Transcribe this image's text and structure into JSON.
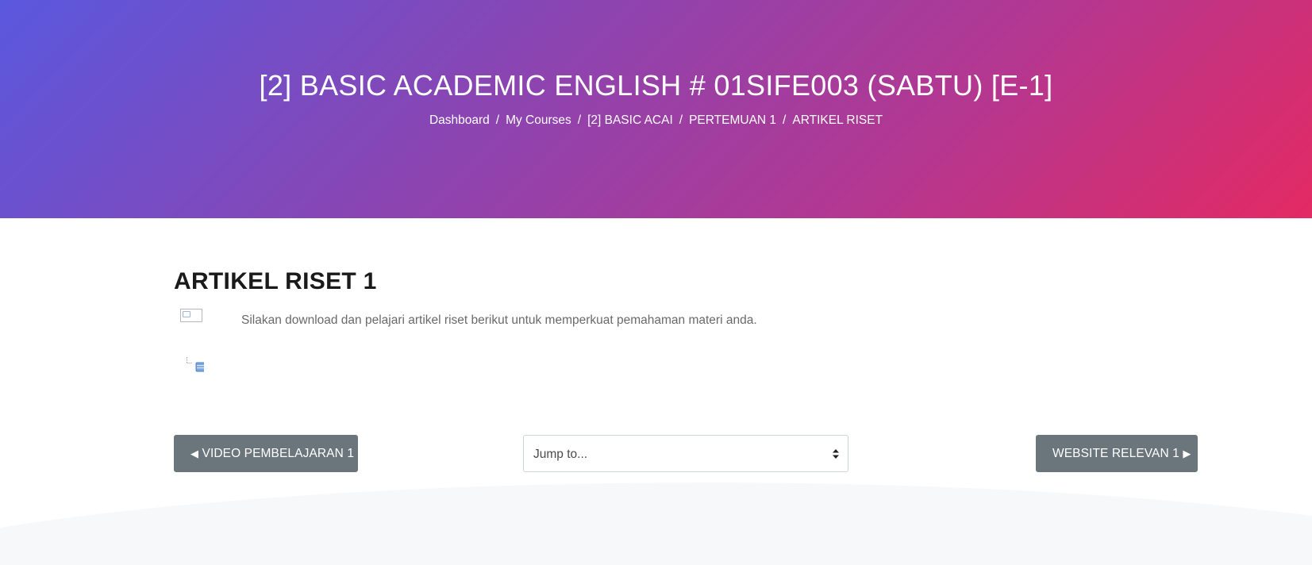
{
  "header": {
    "title": "[2] BASIC ACADEMIC ENGLISH # 01SIFE003 (SABTU) [E-1]",
    "breadcrumb": [
      {
        "label": "Dashboard"
      },
      {
        "label": "My Courses"
      },
      {
        "label": "[2] BASIC ACAI"
      },
      {
        "label": "PERTEMUAN 1"
      },
      {
        "label": "ARTIKEL RISET"
      }
    ],
    "separator": "/"
  },
  "activity": {
    "title": "ARTIKEL RISET 1",
    "intro": "Silakan download dan pelajari artikel riset berikut untuk memperkuat pemahaman materi anda."
  },
  "navigation": {
    "prev_arrow": "◀",
    "prev_label": "VIDEO PEMBELAJARAN 1",
    "next_label": "WEBSITE RELEVAN 1",
    "next_arrow": "▶",
    "jump_to": "Jump to..."
  },
  "icons": {
    "broken_image": "broken-image-icon",
    "folder_tree": "folder-tree-icon",
    "select_caret": "sort-caret-icon"
  },
  "colors": {
    "gradient_start": "#5a58de",
    "gradient_end": "#e32a63",
    "button": "#6b757c",
    "footer": "#f7f8fa"
  }
}
